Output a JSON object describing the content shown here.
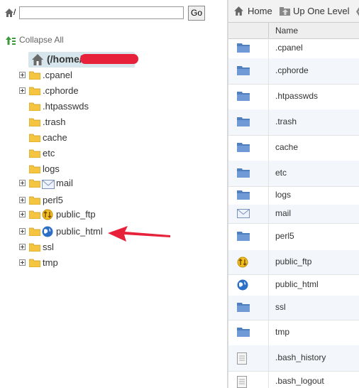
{
  "path_bar": {
    "separator": "/",
    "input_value": "",
    "go_label": "Go"
  },
  "tree": {
    "collapse_label": "Collapse All",
    "root_label": "(/home/",
    "items": [
      {
        "label": ".cpanel",
        "expandable": true,
        "icon": "folder-icon"
      },
      {
        "label": ".cphorde",
        "expandable": true,
        "icon": "folder-icon"
      },
      {
        "label": ".htpasswds",
        "expandable": false,
        "icon": "folder-icon"
      },
      {
        "label": ".trash",
        "expandable": false,
        "icon": "folder-icon"
      },
      {
        "label": "cache",
        "expandable": false,
        "icon": "folder-icon"
      },
      {
        "label": "etc",
        "expandable": false,
        "icon": "folder-icon"
      },
      {
        "label": "logs",
        "expandable": false,
        "icon": "folder-icon"
      },
      {
        "label": "mail",
        "expandable": true,
        "icon": "mail-icon"
      },
      {
        "label": "perl5",
        "expandable": true,
        "icon": "folder-icon"
      },
      {
        "label": "public_ftp",
        "expandable": true,
        "icon": "ftp-icon"
      },
      {
        "label": "public_html",
        "expandable": true,
        "icon": "globe-icon"
      },
      {
        "label": "ssl",
        "expandable": true,
        "icon": "folder-icon"
      },
      {
        "label": "tmp",
        "expandable": true,
        "icon": "folder-icon"
      }
    ]
  },
  "toolbar": {
    "home_label": "Home",
    "up_label": "Up One Level"
  },
  "file_list": {
    "name_header": "Name",
    "rows": [
      {
        "name": ".cpanel",
        "icon": "folder-icon"
      },
      {
        "name": ".cphorde",
        "icon": "folder-icon"
      },
      {
        "name": ".htpasswds",
        "icon": "folder-icon"
      },
      {
        "name": ".trash",
        "icon": "folder-icon"
      },
      {
        "name": "cache",
        "icon": "folder-icon"
      },
      {
        "name": "etc",
        "icon": "folder-icon"
      },
      {
        "name": "logs",
        "icon": "folder-icon"
      },
      {
        "name": "mail",
        "icon": "mail-icon"
      },
      {
        "name": "perl5",
        "icon": "folder-icon"
      },
      {
        "name": "public_ftp",
        "icon": "ftp-icon"
      },
      {
        "name": "public_html",
        "icon": "globe-icon"
      },
      {
        "name": "ssl",
        "icon": "folder-icon"
      },
      {
        "name": "tmp",
        "icon": "folder-icon"
      },
      {
        "name": ".bash_history",
        "icon": "file-icon"
      },
      {
        "name": ".bash_logout",
        "icon": "file-icon"
      }
    ]
  },
  "colors": {
    "annotation_arrow": "#e8213a",
    "folder": "#f5c542",
    "blue_folder": "#4f7fbf",
    "root_highlight": "#d7e6ec"
  }
}
